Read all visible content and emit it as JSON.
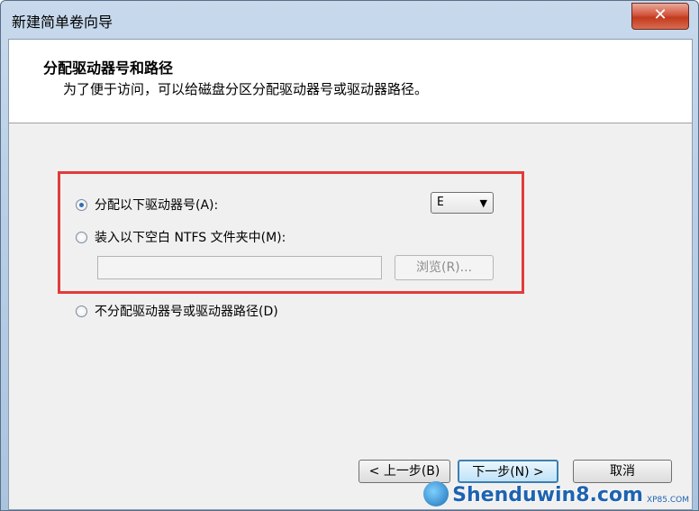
{
  "window": {
    "title": "新建简单卷向导",
    "close_glyph": "✕"
  },
  "header": {
    "title": "分配驱动器号和路径",
    "description": "为了便于访问，可以给磁盘分区分配驱动器号或驱动器路径。"
  },
  "options": {
    "assign_letter": {
      "label": "分配以下驱动器号(A):",
      "checked": true
    },
    "mount_folder": {
      "label": "装入以下空白 NTFS 文件夹中(M):",
      "checked": false
    },
    "no_assign": {
      "label": "不分配驱动器号或驱动器路径(D)",
      "checked": false
    }
  },
  "drive_select": {
    "value": "E",
    "arrow_icon": "chevron-down-icon"
  },
  "folder_path": {
    "value": ""
  },
  "browse_button": {
    "label": "浏览(R)..."
  },
  "footer": {
    "back_label": "< 上一步(B)",
    "next_label": "下一步(N) >",
    "cancel_label": "取消"
  },
  "watermark": {
    "text": "Shenduwin8.com",
    "sub": "XP85.COM"
  },
  "colors": {
    "highlight_border": "#e23b3b",
    "accent": "#2f6fb8"
  }
}
